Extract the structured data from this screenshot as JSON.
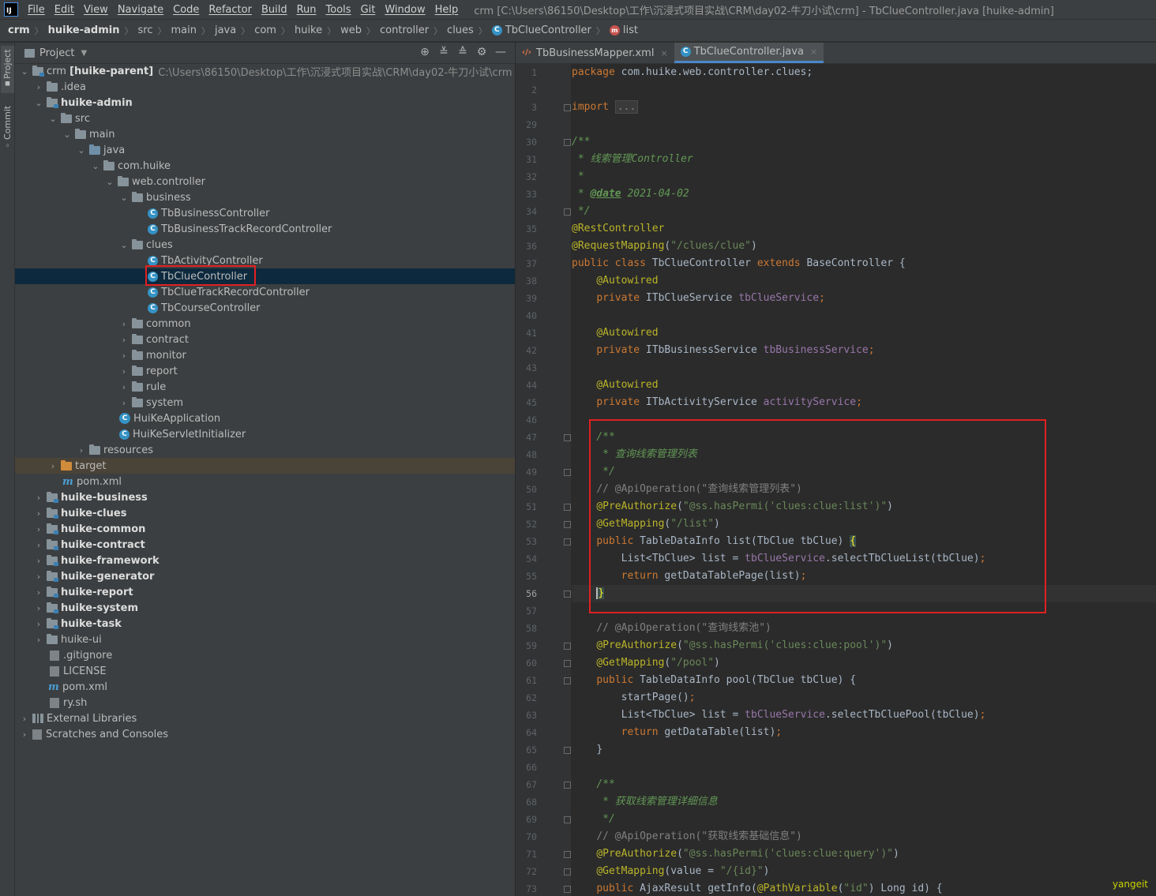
{
  "menubar": {
    "logo": "IJ",
    "items": [
      "File",
      "Edit",
      "View",
      "Navigate",
      "Code",
      "Refactor",
      "Build",
      "Run",
      "Tools",
      "Git",
      "Window",
      "Help"
    ],
    "window_title": "crm [C:\\Users\\86150\\Desktop\\工作\\沉浸式项目实战\\CRM\\day02-牛刀小试\\crm] - TbClueController.java [huike-admin]"
  },
  "breadcrumbs": [
    "crm",
    "huike-admin",
    "src",
    "main",
    "java",
    "com",
    "huike",
    "web",
    "controller",
    "clues",
    "TbClueController",
    "list"
  ],
  "toolstrip": {
    "project": "Project",
    "commit": "Commit"
  },
  "project_panel": {
    "title": "Project",
    "tree": [
      {
        "text": "crm",
        "bold_suffix": "[huike-parent]",
        "path": "C:\\Users\\86150\\Desktop\\工作\\沉浸式项目实战\\CRM\\day02-牛刀小试\\crm"
      },
      {
        "text": ".idea"
      },
      {
        "text": "huike-admin"
      },
      {
        "text": "src"
      },
      {
        "text": "main"
      },
      {
        "text": "java"
      },
      {
        "text": "com.huike"
      },
      {
        "text": "web.controller"
      },
      {
        "text": "business"
      },
      {
        "text": "TbBusinessController"
      },
      {
        "text": "TbBusinessTrackRecordController"
      },
      {
        "text": "clues"
      },
      {
        "text": "TbActivityController"
      },
      {
        "text": "TbClueController"
      },
      {
        "text": "TbClueTrackRecordController"
      },
      {
        "text": "TbCourseController"
      },
      {
        "text": "common"
      },
      {
        "text": "contract"
      },
      {
        "text": "monitor"
      },
      {
        "text": "report"
      },
      {
        "text": "rule"
      },
      {
        "text": "system"
      },
      {
        "text": "HuiKeApplication"
      },
      {
        "text": "HuiKeServletInitializer"
      },
      {
        "text": "resources"
      },
      {
        "text": "target"
      },
      {
        "text": "pom.xml"
      },
      {
        "text": "huike-business"
      },
      {
        "text": "huike-clues"
      },
      {
        "text": "huike-common"
      },
      {
        "text": "huike-contract"
      },
      {
        "text": "huike-framework"
      },
      {
        "text": "huike-generator"
      },
      {
        "text": "huike-report"
      },
      {
        "text": "huike-system"
      },
      {
        "text": "huike-task"
      },
      {
        "text": "huike-ui"
      },
      {
        "text": ".gitignore"
      },
      {
        "text": "LICENSE"
      },
      {
        "text": "pom.xml"
      },
      {
        "text": "ry.sh"
      },
      {
        "text": "External Libraries"
      },
      {
        "text": "Scratches and Consoles"
      }
    ]
  },
  "tabs": [
    {
      "label": "TbBusinessMapper.xml",
      "close": "×"
    },
    {
      "label": "TbClueController.java",
      "close": "×"
    }
  ],
  "editor": {
    "line_numbers": [
      "1",
      "2",
      "3",
      "29",
      "30",
      "31",
      "32",
      "33",
      "34",
      "35",
      "36",
      "37",
      "38",
      "39",
      "40",
      "41",
      "42",
      "43",
      "44",
      "45",
      "46",
      "47",
      "48",
      "49",
      "50",
      "51",
      "52",
      "53",
      "54",
      "55",
      "56",
      "57",
      "58",
      "59",
      "60",
      "61",
      "62",
      "63",
      "64",
      "65",
      "66",
      "67",
      "68",
      "69",
      "70",
      "71",
      "72",
      "73"
    ],
    "tokens": {
      "package_kw": "package",
      "package_name": " com.huike.web.controller.clues;",
      "import_kw": "import",
      "import_dots": "...",
      "jd_open": "/**",
      "jd_title": " * 线索管理Controller",
      "jd_star": " *",
      "jd_date_prefix": " * ",
      "jd_date_tag": "@date",
      "jd_date_val": " 2021-04-02",
      "jd_close": " */",
      "ann_rest": "@RestController",
      "ann_reqmap": "@RequestMapping",
      "reqmap_arg": "\"/clues/clue\"",
      "public": "public",
      "class": "class",
      "extends": "extends",
      "class_name": " TbClueController ",
      "base_class": " BaseController {",
      "autowired": "@Autowired",
      "private": "private",
      "type_clue_service": " ITbClueService ",
      "field_clue_service": "tbClueService",
      "type_business_service": " ITbBusinessService ",
      "field_business_service": "tbBusinessService",
      "type_activity_service": " ITbActivityService ",
      "field_activity_service": "activityService",
      "semicolon": ";",
      "jd_list_title": " * 查询线索管理列表",
      "apiop_list": "// @ApiOperation(\"查询线索管理列表\")",
      "preauth": "@PreAuthorize",
      "preauth_list_arg": "\"@ss.hasPermi('clues:clue:list')\"",
      "getmapping": "@GetMapping",
      "getmapping_list_arg": "\"/list\"",
      "list_sig": " TableDataInfo list(TbClue tbClue) ",
      "open_brace": "{",
      "list_body1": "List<TbClue> list = ",
      "list_body1_field": "tbClueService",
      "list_body1_tail": ".selectTbClueList(tbClue)",
      "return_kw": "return",
      "list_body2": " getDataTablePage(list)",
      "close_brace": "}",
      "apiop_pool": "// @ApiOperation(\"查询线索池\")",
      "preauth_pool_arg": "\"@ss.hasPermi('clues:clue:pool')\"",
      "getmapping_pool_arg": "\"/pool\"",
      "pool_sig": " TableDataInfo pool(TbClue tbClue) {",
      "pool_body1": "startPage()",
      "pool_body2_tail": ".selectTbCluePool(tbClue)",
      "pool_body3": " getDataTable(list)",
      "jd_info_title": " * 获取线索管理详细信息",
      "apiop_info": "// @ApiOperation(\"获取线索基础信息\")",
      "preauth_info_arg": "\"@ss.hasPermi('clues:clue:query')\"",
      "getmapping_info_pre": "(value = ",
      "getmapping_info_arg": "\"/{id}\"",
      "info_sig_pre": " AjaxResult getInfo(",
      "pathvar": "@PathVariable",
      "pathvar_arg": "\"id\"",
      "info_sig_post": ") Long id) {",
      "lparen": "(",
      "rparen": ")"
    }
  },
  "watermark": "yangeit",
  "colors": {
    "keyword": "#cc7832",
    "annotation": "#bbb529",
    "string": "#6a8759",
    "doc_comment": "#629755",
    "highlight_box": "#e02020",
    "selection": "#0d293e"
  }
}
